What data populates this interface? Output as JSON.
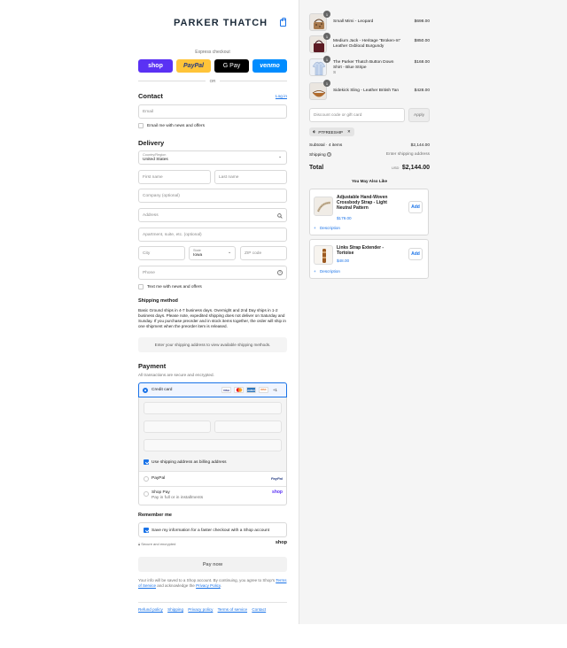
{
  "header": {
    "brand": "PARKER THATCH",
    "cart_icon": "shopping-bag-icon"
  },
  "express": {
    "title": "Express checkout",
    "buttons": [
      "shop",
      "PayPal",
      "G Pay",
      "venmo"
    ],
    "or_label": "OR",
    "colors": {
      "shop": "#5a31f4",
      "paypal": "#ffc439",
      "gpay": "#000000",
      "venmo": "#008cff"
    }
  },
  "contact": {
    "heading": "Contact",
    "login_link": "Log in",
    "email_placeholder": "Email",
    "email_news_label": "Email me with news and offers"
  },
  "delivery": {
    "heading": "Delivery",
    "country_label": "Country/Region",
    "country_value": "United States",
    "first_name": "First name",
    "last_name": "Last name",
    "company": "Company (optional)",
    "address": "Address",
    "apartment": "Apartment, suite, etc. (optional)",
    "city": "City",
    "state_label": "State",
    "state_value": "Iowa",
    "zip": "ZIP code",
    "phone": "Phone",
    "text_news_label": "Text me with news and offers"
  },
  "shipping": {
    "heading": "Shipping method",
    "note": "Basic Ground ships in 4-7 business days. Overnight and 2nd Day ships in 1-2 business days. Please note, expedited shipping does not deliver on Saturday and Sunday. If you purchase preorder and in stock items together, the order will ship in one shipment when the preorder item is released.",
    "placeholder": "Enter your shipping address to view available shipping methods."
  },
  "payment": {
    "heading": "Payment",
    "subtitle": "All transactions are secure and encrypted.",
    "credit_card_label": "Credit card",
    "card_brands": [
      "VISA",
      "MC",
      "AMEX",
      "DISC"
    ],
    "more_brands": "+1",
    "billing_label": "Use shipping address as billing address",
    "paypal_label": "PayPal",
    "paypal_logo": "PayPal",
    "shoppay_label": "Shop Pay",
    "shoppay_sub": "Pay in full or in installments",
    "shoppay_logo": "shop"
  },
  "remember": {
    "heading": "Remember me",
    "save_label": "Save my information for a faster checkout with a Shop account",
    "secure_label": "Secure and encrypted",
    "shop_logo": "shop"
  },
  "pay_button": "Pay now",
  "legal": {
    "pre": "Your info will be saved to a Shop account. By continuing, you agree to Shop's",
    "terms": "Terms of Service",
    "mid": "and acknowledge the",
    "privacy": "Privacy Policy",
    "end": "."
  },
  "footer_links": [
    "Refund policy",
    "Shipping",
    "Privacy policy",
    "Terms of service",
    "Contact"
  ],
  "cart": {
    "items": [
      {
        "qty": "1",
        "name": "Small Mimi - Leopard",
        "price": "$698.00"
      },
      {
        "qty": "1",
        "name": "Medium Jack - Heritage \"Broken-In\" Leather Oxblood Burgundy",
        "price": "$850.00"
      },
      {
        "qty": "1",
        "name": "The Parker Thatch Button Down Shirt - Blue Stripe",
        "variant": "S",
        "price": "$168.00"
      },
      {
        "qty": "1",
        "name": "Sidekick Sling - Leather British Tan",
        "price": "$428.00"
      }
    ],
    "discount_placeholder": "Discount code or gift card",
    "apply_label": "Apply",
    "discount_tag": "PTFREESHIP",
    "subtotal_label": "Subtotal · 4 items",
    "subtotal_value": "$2,144.00",
    "shipping_label": "Shipping",
    "shipping_value": "Enter shipping address",
    "total_label": "Total",
    "currency": "USD",
    "total_value": "$2,144.00"
  },
  "recommendations": {
    "heading": "You May Also Like",
    "items": [
      {
        "name": "Adjustable Hand-Woven Crossbody Strap - Light Neutral Pattern",
        "price": "$179.00",
        "add_label": "Add",
        "desc_label": "Description"
      },
      {
        "name": "Links Strap Extender - Tortoise",
        "price": "$48.00",
        "add_label": "Add",
        "desc_label": "Description"
      }
    ]
  }
}
